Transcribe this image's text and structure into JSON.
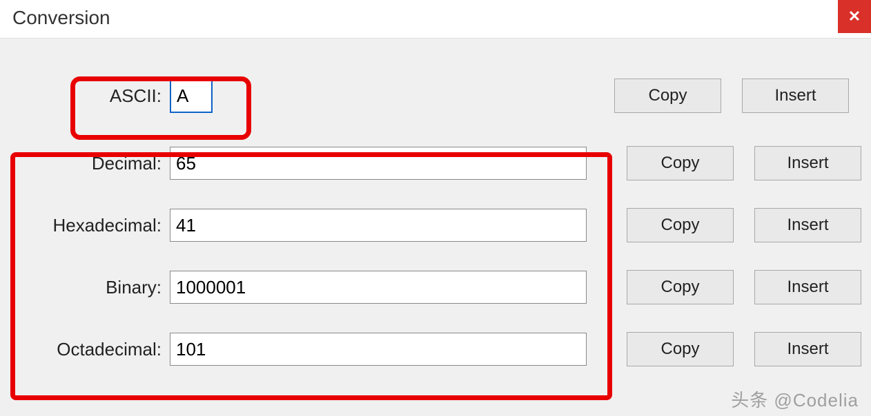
{
  "title": "Conversion",
  "close_icon": "✕",
  "rows": {
    "ascii": {
      "label": "ASCII:",
      "value": "A"
    },
    "decimal": {
      "label": "Decimal:",
      "value": "65"
    },
    "hex": {
      "label": "Hexadecimal:",
      "value": "41"
    },
    "binary": {
      "label": "Binary:",
      "value": "1000001"
    },
    "octal": {
      "label": "Octadecimal:",
      "value": "101"
    }
  },
  "buttons": {
    "copy": "Copy",
    "insert": "Insert"
  },
  "watermark": "头条 @Codelia"
}
